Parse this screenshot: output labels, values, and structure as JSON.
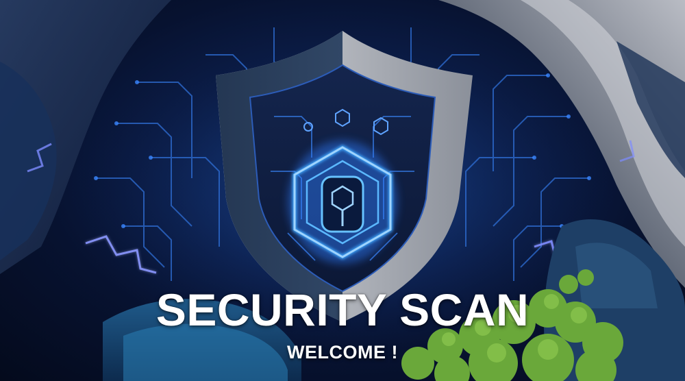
{
  "banner": {
    "title": "SECURITY SCAN",
    "subtitle": "WELCOME !"
  },
  "icons": {
    "emblem": "shield-icon",
    "inner_emblem": "hexagon-lock-icon",
    "circuits": "circuit-pattern-icon"
  },
  "colors": {
    "background": "#0b1c46",
    "glow": "#3fa9ff",
    "lightning": "#6b7cff",
    "shield_dark": "#1c2d4a",
    "shield_light": "#c9ccd2",
    "moss": "#6aa83a",
    "text": "#ffffff"
  }
}
